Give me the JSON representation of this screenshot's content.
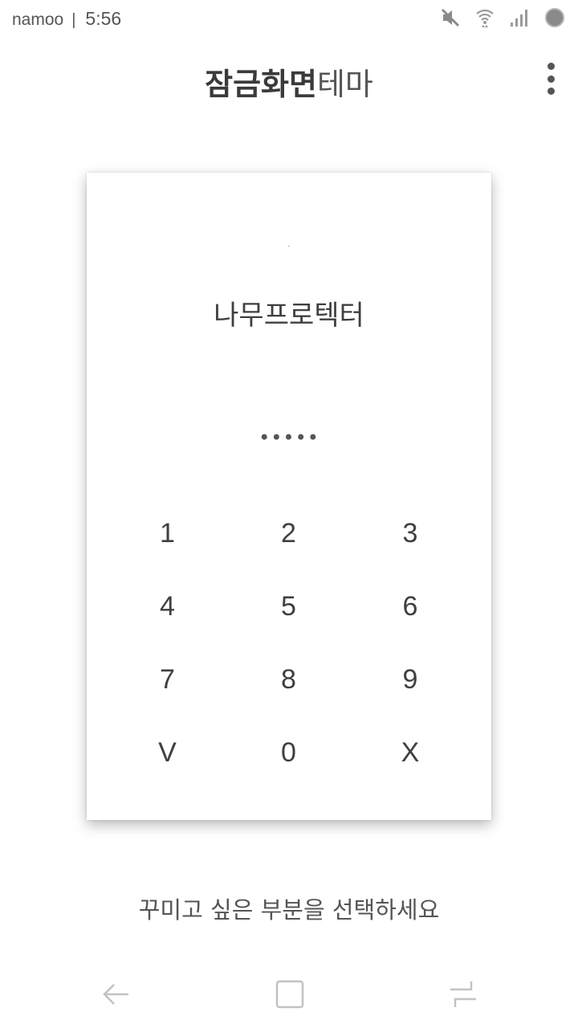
{
  "status_bar": {
    "carrier": "namoo",
    "separator": "|",
    "time": "5:56",
    "icons": [
      "mute-icon",
      "wifi-icon",
      "signal-icon",
      "battery-icon"
    ]
  },
  "header": {
    "title_bold": "잠금화면",
    "title_light": "테마",
    "menu_icon": "more-vert-icon"
  },
  "preview": {
    "title": "나무프로텍터",
    "pin_dots": "•••••",
    "keypad": [
      [
        "1",
        "2",
        "3"
      ],
      [
        "4",
        "5",
        "6"
      ],
      [
        "7",
        "8",
        "9"
      ],
      [
        "V",
        "0",
        "X"
      ]
    ]
  },
  "hint": "꾸미고 싶은 부분을 선택하세요",
  "nav_bar": {
    "icons": [
      "back-icon",
      "home-icon",
      "recents-icon"
    ]
  },
  "colors": {
    "background": "#ffffff",
    "text": "#3a3a3a",
    "icon": "#9a9a9a"
  }
}
